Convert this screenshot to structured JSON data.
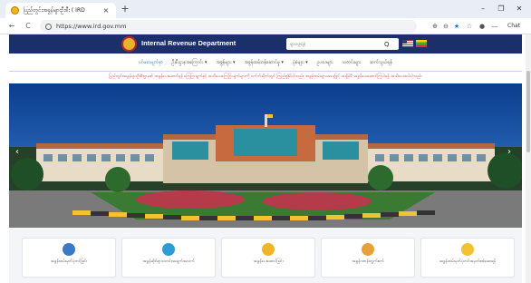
{
  "browser": {
    "tab_title": "ပြည်တွင်းအခွန်များဦးစီး ( IRD",
    "tab_close": "×",
    "new_tab": "+",
    "window_minimize": "–",
    "window_restore": "❐",
    "window_close": "✕",
    "nav_back": "←",
    "nav_refresh": "C",
    "nav_info": "ⓘ",
    "url": "https://www.ird.gov.mm",
    "icons": [
      "zoom-icon",
      "translate-icon",
      "star-icon",
      "favorites-icon",
      "extensions-icon",
      "profile-icon",
      "more-icon"
    ],
    "chat_label": "Chat"
  },
  "site": {
    "title": "Internal Revenue Department",
    "search_placeholder": "ရှာဖွေရန်",
    "search_icon": "Q",
    "nav": [
      {
        "label": "ပင်မစာမျက်နှာ",
        "active": true
      },
      {
        "label": "ဦးစီးဌာနအကြောင်း ▾",
        "active": false
      },
      {
        "label": "အခွန်များ ▾",
        "active": false
      },
      {
        "label": "အခွန်ထမ်းဝန်ဆောင်မှု ▾",
        "active": false
      },
      {
        "label": "ပုံစံများ ▾",
        "active": false
      },
      {
        "label": "ဥပဒေများ",
        "active": false
      },
      {
        "label": "သတင်းများ",
        "active": false
      },
      {
        "label": "ဆက်သွယ်ရန်",
        "active": false
      }
    ],
    "ticker": "ပြည်တွင်းအခွန်များဦးစီးဌာန၏ အခွန်ပေးဆောင်ရန် ကြေငြာချက်နှင့် အသိပေးကြေငြာချက်များကို ဝက်ဘ်ဆိုက်တွင် ကြည့်ရှုနိုင်ပါသည်။ အခွန်ထမ်းများအနေဖြင့် အချိန်မီ အခွန်ပေးဆောင်ကြပါရန် အသိပေးအပ်ပါသည်။",
    "slider_prev": "‹",
    "slider_next": "›",
    "cards": [
      {
        "label": "အခွန်ထမ်းမှတ်ပုံတင်ခြင်း",
        "icon": "computer-icon",
        "color": "#3a78c9"
      },
      {
        "label": "အခွန်ဆိုင်ရာသတင်းအချက်အလက်",
        "icon": "globe-icon",
        "color": "#2f9bd6"
      },
      {
        "label": "အခွန်ပေးဆောင်ခြင်း",
        "icon": "coin-icon",
        "color": "#f0b429"
      },
      {
        "label": "အခွန်ဂဏန်းတွက်စက်",
        "icon": "calculator-icon",
        "color": "#e8a13a"
      },
      {
        "label": "အခွန်ထမ်းမှတ်ပုံတင်အမှတ်စစ်ဆေးရန်",
        "icon": "certificate-icon",
        "color": "#f2c230"
      }
    ]
  }
}
